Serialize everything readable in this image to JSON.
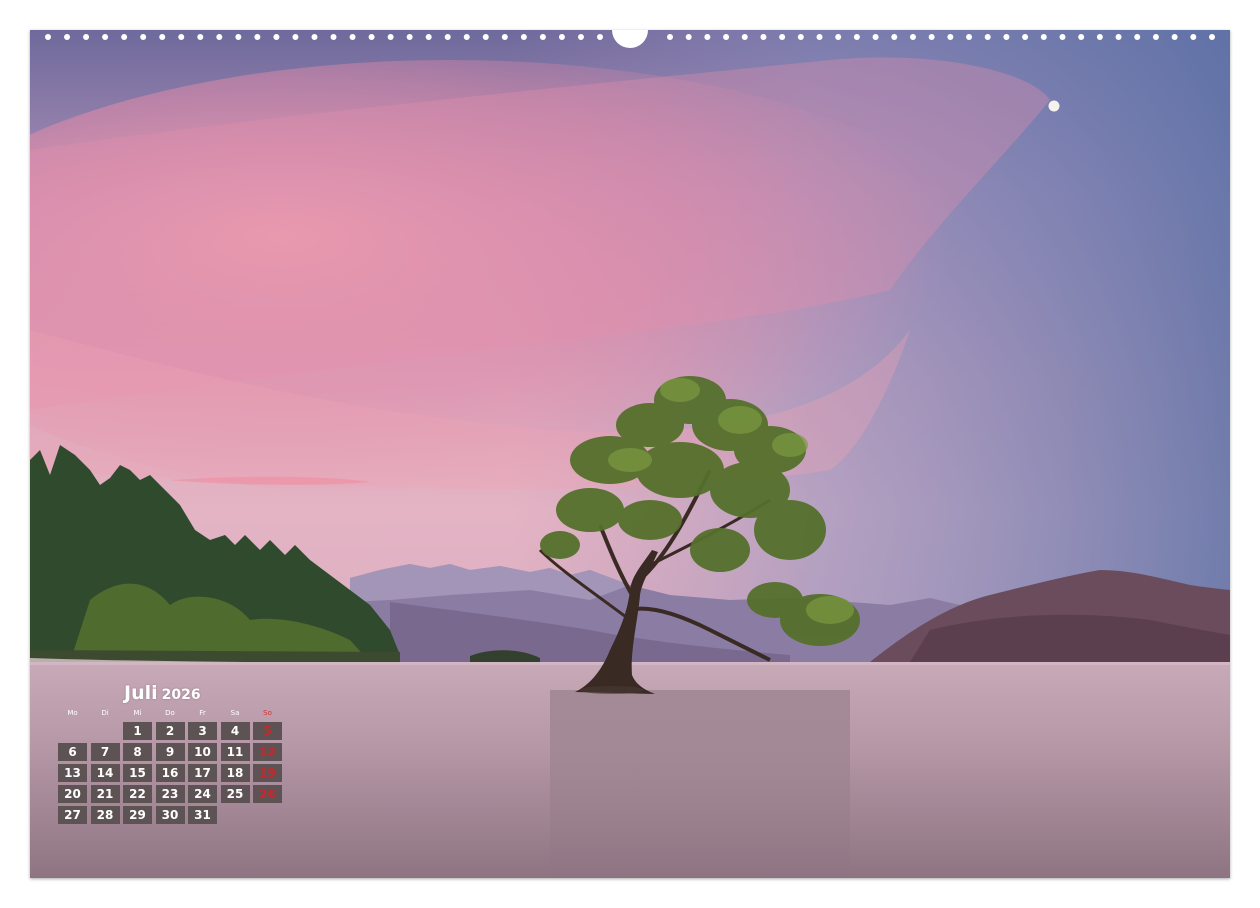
{
  "calendar": {
    "month": "Juli",
    "year": "2026",
    "weekdays": [
      "Mo",
      "Di",
      "Mi",
      "Do",
      "Fr",
      "Sa",
      "So"
    ],
    "leading_empty": 2,
    "days": [
      "1",
      "2",
      "3",
      "4",
      "5",
      "6",
      "7",
      "8",
      "9",
      "10",
      "11",
      "12",
      "13",
      "14",
      "15",
      "16",
      "17",
      "18",
      "19",
      "20",
      "21",
      "22",
      "23",
      "24",
      "25",
      "26",
      "27",
      "28",
      "29",
      "30",
      "31"
    ],
    "sunday_color": "#c9272b",
    "cell_color": "#5d5254"
  },
  "photo": {
    "subject": "lone-tree-in-lake-icon",
    "sky_top": "#6c6a9a",
    "sky_pink": "#e6a0b4",
    "water": "#b89aa8"
  },
  "binding": {
    "hole_count": 60,
    "hanger": "hanger-notch-icon"
  }
}
